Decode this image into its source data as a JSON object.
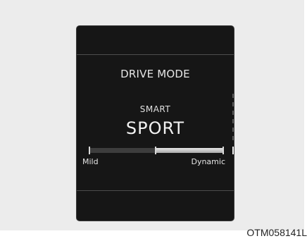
{
  "display": {
    "title": "DRIVE MODE",
    "submode": "SMART",
    "mode": "SPORT"
  },
  "gauge": {
    "left_label": "Mild",
    "right_label": "Dynamic",
    "fill_start_fraction": 0.49,
    "fill_end_fraction": 1.0
  },
  "figure_code": "OTM058141L",
  "colors": {
    "screen_bg": "#161616",
    "frame_bg": "#ececec",
    "text": "#e6e6e6",
    "gauge_track": "#3d3d3d",
    "gauge_fill": "#d0d0d0"
  }
}
